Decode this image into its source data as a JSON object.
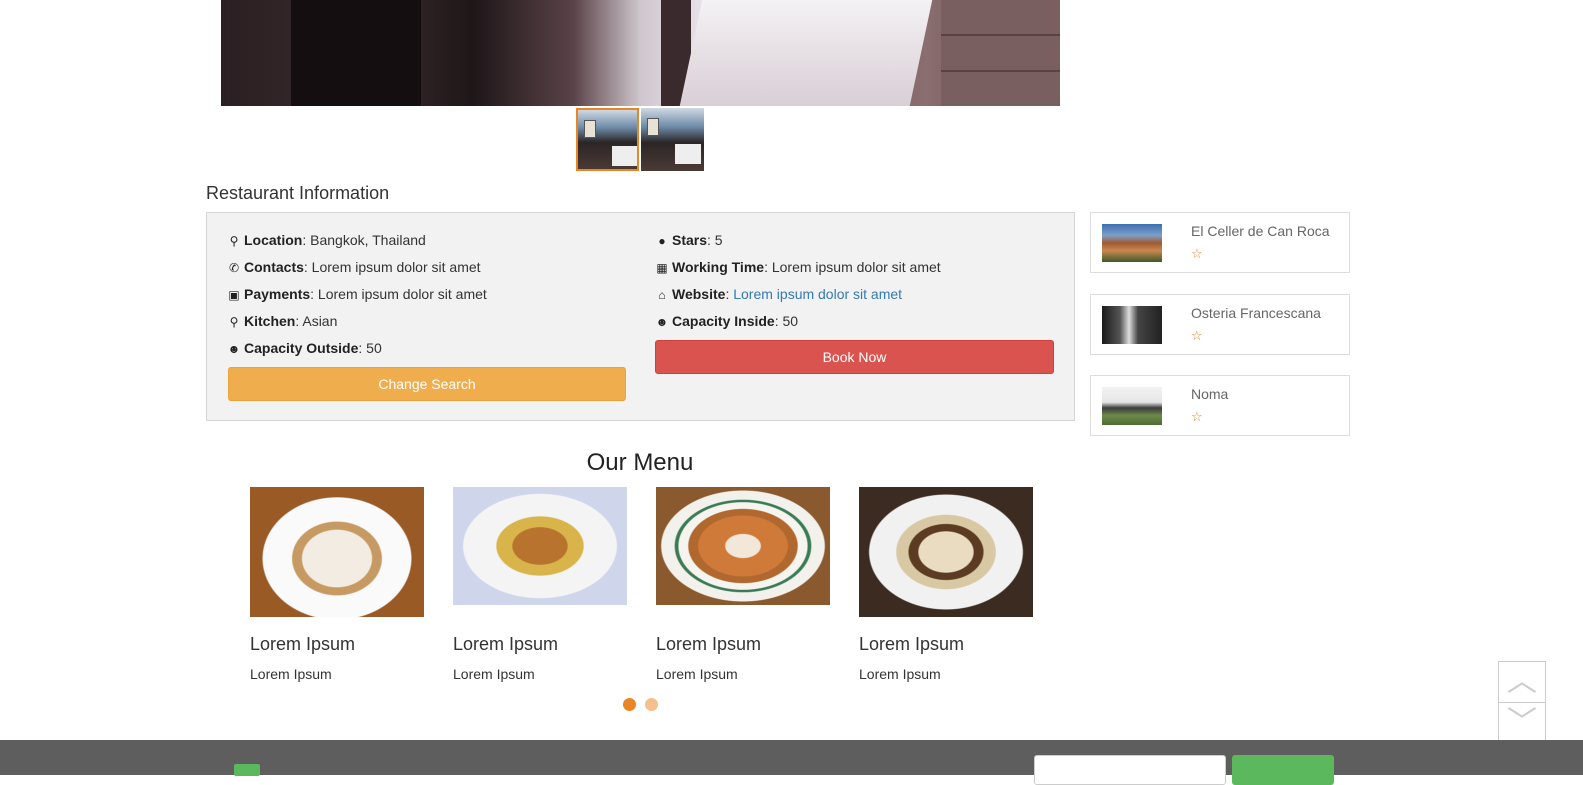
{
  "section_title": "Restaurant Information",
  "info": {
    "left": [
      {
        "icon": "map-marker-icon",
        "glyph": "⚲",
        "label": "Location",
        "value": ": Bangkok, Thailand"
      },
      {
        "icon": "phone-icon",
        "glyph": "✆",
        "label": "Contacts",
        "value": ": Lorem ipsum dolor sit amet"
      },
      {
        "icon": "money-icon",
        "glyph": "▣",
        "label": "Payments",
        "value": ": Lorem ipsum dolor sit amet"
      },
      {
        "icon": "map-marker-icon",
        "glyph": "⚲",
        "label": "Kitchen",
        "value": ": Asian"
      },
      {
        "icon": "users-icon",
        "glyph": "☻",
        "label": "Capacity Outside",
        "value": ": 50"
      }
    ],
    "right": [
      {
        "icon": "comment-icon",
        "glyph": "●",
        "label": "Stars",
        "value": ": 5"
      },
      {
        "icon": "calendar-icon",
        "glyph": "▦",
        "label": "Working Time",
        "value": ": Lorem ipsum dolor sit amet"
      },
      {
        "icon": "home-icon",
        "glyph": "⌂",
        "label": "Website",
        "value": ": ",
        "link": "Lorem ipsum dolor sit amet"
      },
      {
        "icon": "users-icon",
        "glyph": "☻",
        "label": "Capacity Inside",
        "value": ": 50"
      }
    ],
    "change_search": "Change Search",
    "book_now": "Book Now"
  },
  "sidebar": [
    {
      "name": "El Celler de Can Roca",
      "star": "☆"
    },
    {
      "name": "Osteria Francescana",
      "star": "☆"
    },
    {
      "name": "Noma",
      "star": "☆"
    }
  ],
  "menu": {
    "title": "Our Menu",
    "items": [
      {
        "title": "Lorem Ipsum",
        "subtitle": "Lorem Ipsum"
      },
      {
        "title": "Lorem Ipsum",
        "subtitle": "Lorem Ipsum"
      },
      {
        "title": "Lorem Ipsum",
        "subtitle": "Lorem Ipsum"
      },
      {
        "title": "Lorem Ipsum",
        "subtitle": "Lorem Ipsum"
      }
    ]
  },
  "scroll": {
    "up": "︿",
    "down": "﹀"
  },
  "colors": {
    "accent": "#e98524",
    "warning": "#f0ad4e",
    "danger": "#d9534f",
    "link": "#337ab7",
    "footer": "#5e5e5e"
  }
}
